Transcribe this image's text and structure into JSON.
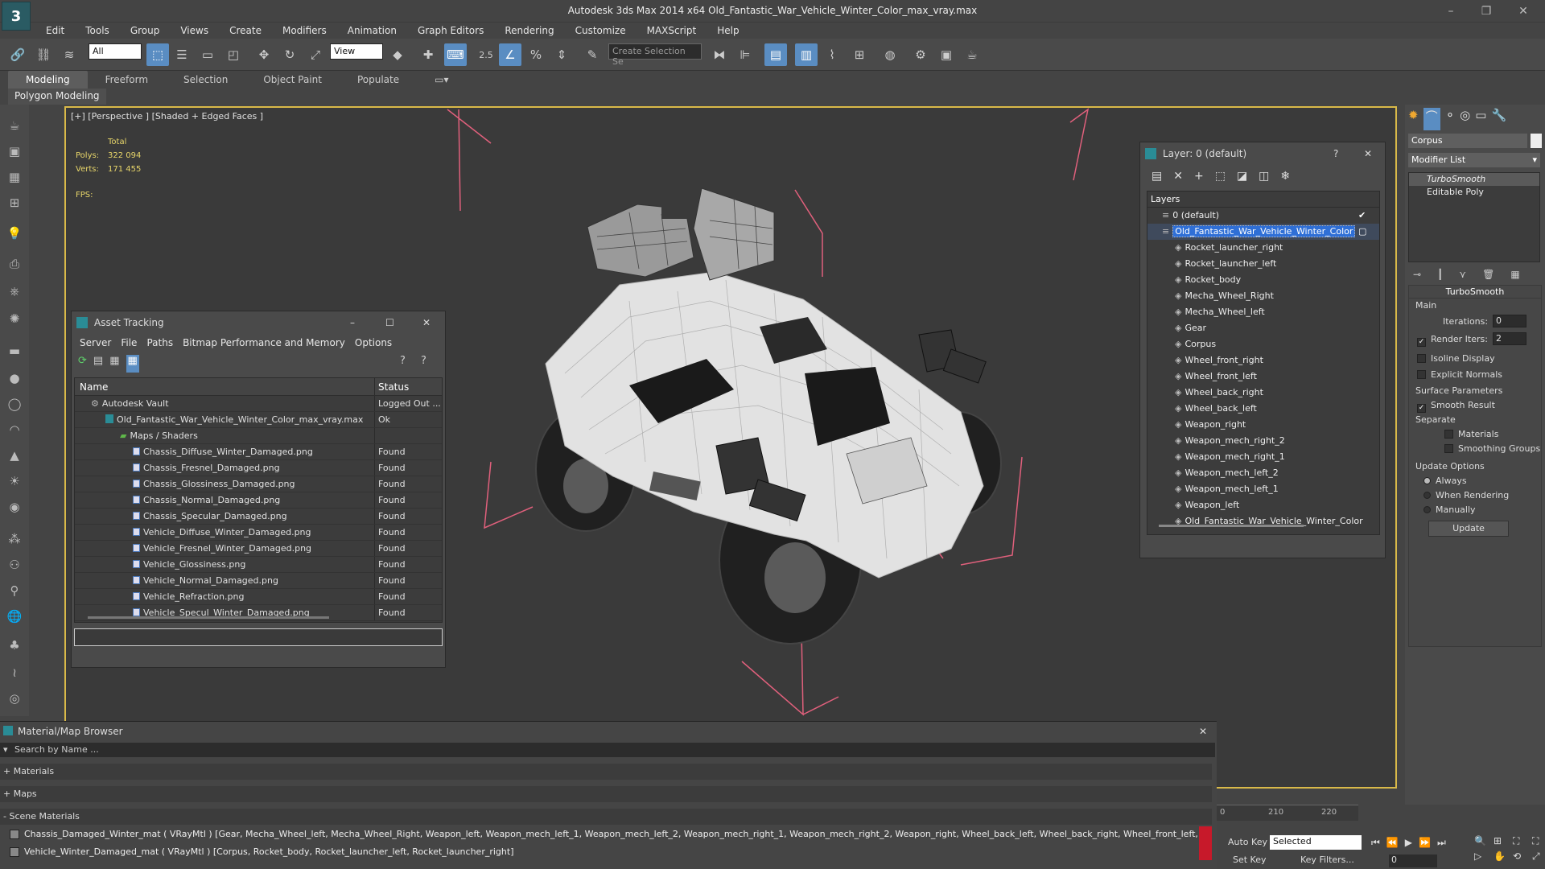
{
  "window": {
    "title": "Autodesk 3ds Max  2014 x64    Old_Fantastic_War_Vehicle_Winter_Color_max_vray.max",
    "logo": "3"
  },
  "menu": [
    "Edit",
    "Tools",
    "Group",
    "Views",
    "Create",
    "Modifiers",
    "Animation",
    "Graph Editors",
    "Rendering",
    "Customize",
    "MAXScript",
    "Help"
  ],
  "toolbar": {
    "filter_value": "All",
    "refcoord_value": "View",
    "snap_label": "2.5",
    "selection_set_placeholder": "Create Selection Se"
  },
  "ribbon": {
    "tabs": [
      "Modeling",
      "Freeform",
      "Selection",
      "Object Paint",
      "Populate"
    ],
    "sub_label": "Polygon Modeling"
  },
  "viewport": {
    "label": "[+] [Perspective ] [Shaded + Edged Faces ]",
    "stats": {
      "total_label": "Total",
      "polys_label": "Polys:",
      "polys_value": "322 094",
      "verts_label": "Verts:",
      "verts_value": "171 455",
      "fps_label": "FPS:"
    }
  },
  "asset_tracking": {
    "title": "Asset Tracking",
    "menu": [
      "Server",
      "File",
      "Paths",
      "Bitmap Performance and Memory",
      "Options"
    ],
    "columns": [
      "Name",
      "Status"
    ],
    "rows": [
      {
        "name": "Autodesk Vault",
        "status": "Logged Out ..."
      },
      {
        "name": "Old_Fantastic_War_Vehicle_Winter_Color_max_vray.max",
        "status": "Ok"
      },
      {
        "name": "Maps / Shaders",
        "status": ""
      },
      {
        "name": "Chassis_Diffuse_Winter_Damaged.png",
        "status": "Found"
      },
      {
        "name": "Chassis_Fresnel_Damaged.png",
        "status": "Found"
      },
      {
        "name": "Chassis_Glossiness_Damaged.png",
        "status": "Found"
      },
      {
        "name": "Chassis_Normal_Damaged.png",
        "status": "Found"
      },
      {
        "name": "Chassis_Specular_Damaged.png",
        "status": "Found"
      },
      {
        "name": "Vehicle_Diffuse_Winter_Damaged.png",
        "status": "Found"
      },
      {
        "name": "Vehicle_Fresnel_Winter_Damaged.png",
        "status": "Found"
      },
      {
        "name": "Vehicle_Glossiness.png",
        "status": "Found"
      },
      {
        "name": "Vehicle_Normal_Damaged.png",
        "status": "Found"
      },
      {
        "name": "Vehicle_Refraction.png",
        "status": "Found"
      },
      {
        "name": "Vehicle_Specul_Winter_Damaged.png",
        "status": "Found"
      }
    ]
  },
  "layers": {
    "title": "Layer: 0 (default)",
    "header": "Layers",
    "items": [
      "0 (default)",
      "Old_Fantastic_War_Vehicle_Winter_Color",
      "Rocket_launcher_right",
      "Rocket_launcher_left",
      "Rocket_body",
      "Mecha_Wheel_Right",
      "Mecha_Wheel_left",
      "Gear",
      "Corpus",
      "Wheel_front_right",
      "Wheel_front_left",
      "Wheel_back_right",
      "Wheel_back_left",
      "Weapon_right",
      "Weapon_mech_right_2",
      "Weapon_mech_right_1",
      "Weapon_mech_left_2",
      "Weapon_mech_left_1",
      "Weapon_left",
      "Old_Fantastic_War_Vehicle_Winter_Color"
    ]
  },
  "command_panel": {
    "object_name": "Corpus",
    "modifier_list": "Modifier List",
    "stack": [
      "TurboSmooth",
      "Editable Poly"
    ],
    "rollout_title": "TurboSmooth",
    "main_label": "Main",
    "iterations_label": "Iterations:",
    "iterations_value": "0",
    "render_iters_label": "Render Iters:",
    "render_iters_value": "2",
    "isoline_label": "Isoline Display",
    "explicit_normals_label": "Explicit Normals",
    "surface_params_label": "Surface Parameters",
    "smooth_result_label": "Smooth Result",
    "separate_label": "Separate",
    "materials_label": "Materials",
    "smoothing_groups_label": "Smoothing Groups",
    "update_options_label": "Update Options",
    "always_label": "Always",
    "when_rendering_label": "When Rendering",
    "manually_label": "Manually",
    "update_button": "Update"
  },
  "material_browser": {
    "title": "Material/Map Browser",
    "search_placeholder": "Search by Name ...",
    "groups": [
      "+ Materials",
      "+ Maps",
      "- Scene Materials"
    ],
    "materials": [
      "Chassis_Damaged_Winter_mat  ( VRayMtl ) [Gear, Mecha_Wheel_left, Mecha_Wheel_Right, Weapon_left, Weapon_mech_left_1, Weapon_mech_left_2, Weapon_mech_right_1, Weapon_mech_right_2, Weapon_right, Wheel_back_left, Wheel_back_right, Wheel_front_left, Wheel_front_rig...",
      "Vehicle_Winter_Damaged_mat  ( VRayMtl ) [Corpus, Rocket_body, Rocket_launcher_left, Rocket_launcher_right]"
    ]
  },
  "timeline": {
    "tick_210": "210",
    "tick_220": "220",
    "auto_key": "Auto Key",
    "key_mode": "Selected",
    "set_key": "Set Key",
    "key_filters": "Key Filters...",
    "frame_value": "0"
  }
}
